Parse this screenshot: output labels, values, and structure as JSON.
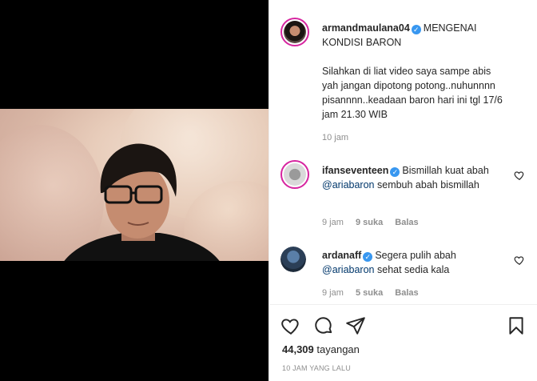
{
  "post": {
    "username": "armandmaulana04",
    "caption_title": "MENGENAI KONDISI BARON",
    "caption_body": "Silahkan di liat video saya sampe abis yah jangan dipotong potong..nuhunnnn pisannnn..keadaan baron hari ini tgl 17/6 jam 21.30 WIB",
    "age": "10 jam"
  },
  "comments": [
    {
      "username": "ifanseventeen",
      "text_before": "Bismillah kuat abah ",
      "mention": "@ariabaron",
      "text_after": " sembuh abah bismillah",
      "age": "9 jam",
      "likes": "9 suka",
      "reply": "Balas"
    },
    {
      "username": "ardanaff",
      "text_before": "Segera pulih abah ",
      "mention": "@ariabaron",
      "text_after": " sehat sedia kala",
      "age": "9 jam",
      "likes": "5 suka",
      "reply": "Balas"
    }
  ],
  "footer": {
    "views_count": "44,309",
    "views_word": "tayangan",
    "timestamp": "10 JAM YANG LALU"
  },
  "icons": {
    "like": "heart-icon",
    "comment": "comment-icon",
    "share": "paper-plane-icon",
    "save": "bookmark-icon",
    "verified": "verified-badge-icon"
  },
  "colors": {
    "verified": "#3897f0",
    "mention": "#00376b",
    "meta": "#8e8e8e",
    "story_ring": "#d6249f"
  }
}
